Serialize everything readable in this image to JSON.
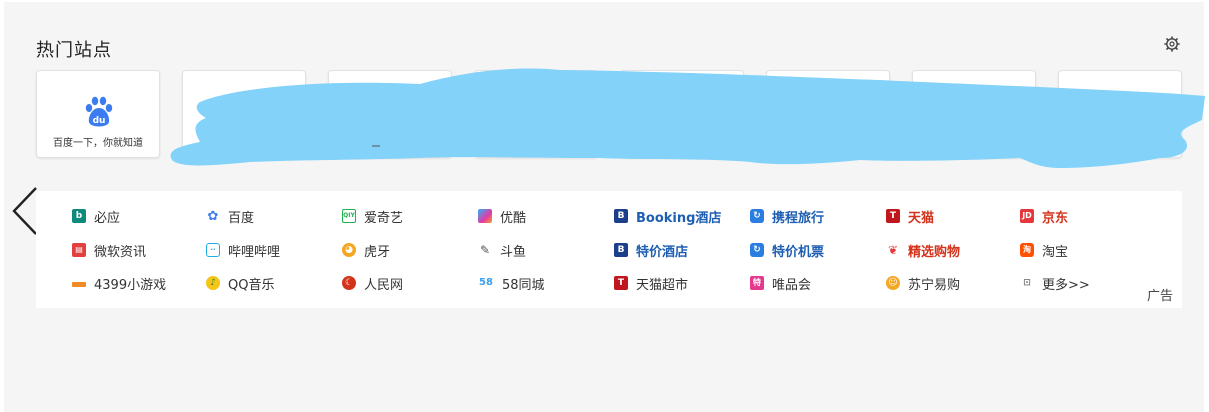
{
  "hot_sites": {
    "title": "热门站点",
    "settings_icon": "gear-icon",
    "tiles": [
      {
        "label": "百度一下，你就知道",
        "icon": "baidu-paw-icon"
      },
      {
        "label": "",
        "icon": ""
      },
      {
        "label": "",
        "icon": ""
      },
      {
        "label": "",
        "icon": ""
      },
      {
        "label": "",
        "icon": ""
      },
      {
        "label": "",
        "icon": ""
      },
      {
        "label": "",
        "icon": ""
      },
      {
        "label": "",
        "icon": ""
      },
      {
        "label": "",
        "icon": ""
      }
    ]
  },
  "nav_prev_icon": "chevron-left-icon",
  "links": {
    "row1": [
      "必应",
      "百度",
      "爱奇艺",
      "优酷",
      "Booking酒店",
      "携程旅行",
      "天猫",
      "京东"
    ],
    "row2": [
      "微软资讯",
      "哔哩哔哩",
      "虎牙",
      "斗鱼",
      "特价酒店",
      "特价机票",
      "精选购物",
      "淘宝"
    ],
    "row3": [
      "4399小游戏",
      "QQ音乐",
      "人民网",
      "58同城",
      "天猫超市",
      "唯品会",
      "苏宁易购",
      "更多>>"
    ]
  },
  "ad_label": "广告",
  "colors": {
    "panel_bg": "#f5f5f5",
    "link_blue": "#1e5fb3",
    "link_red": "#d4331b",
    "redaction": "#82d2fa"
  }
}
